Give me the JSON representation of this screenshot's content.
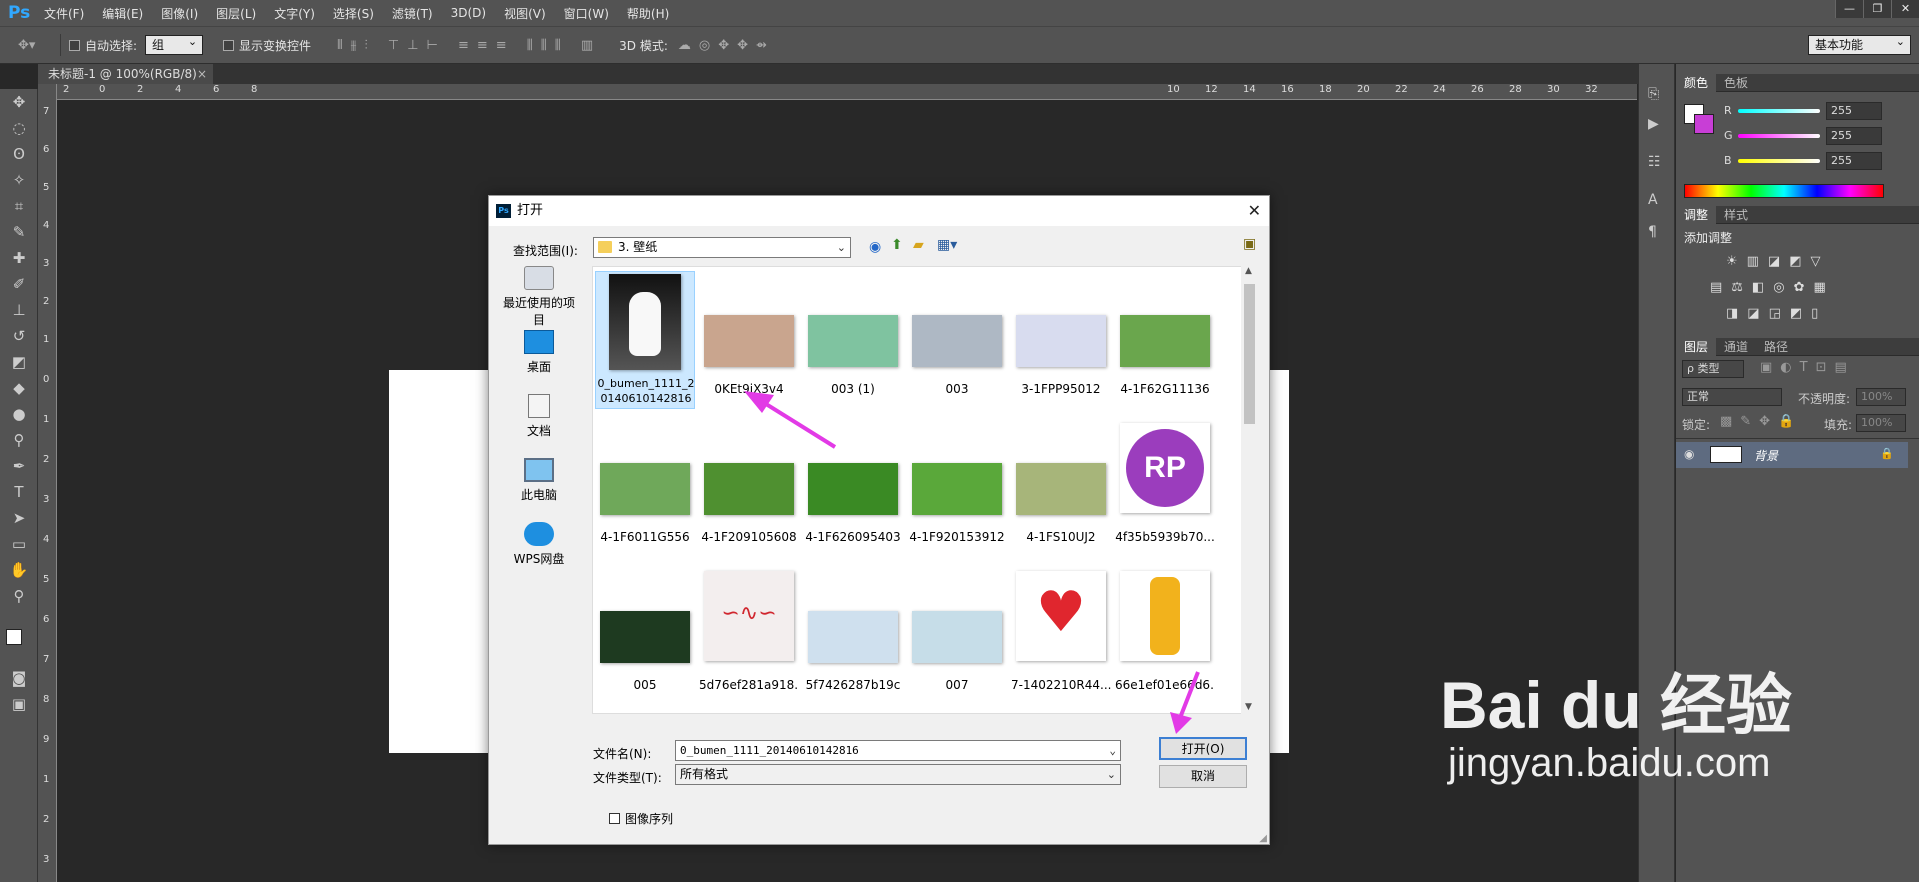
{
  "app": {
    "logo": "Ps"
  },
  "menu": [
    "文件(F)",
    "编辑(E)",
    "图像(I)",
    "图层(L)",
    "文字(Y)",
    "选择(S)",
    "滤镜(T)",
    "3D(D)",
    "视图(V)",
    "窗口(W)",
    "帮助(H)"
  ],
  "window_buttons": [
    "—",
    "❐",
    "✕"
  ],
  "options": {
    "auto_select_label": "自动选择:",
    "auto_select_value": "组",
    "show_transform_label": "显示变换控件",
    "mode3d_label": "3D 模式:",
    "workspace": "基本功能"
  },
  "document_tab": "未标题-1 @ 100%(RGB/8)",
  "ruler_h": [
    "2",
    "0",
    "2",
    "4",
    "6",
    "8",
    "10",
    "12",
    "14",
    "16",
    "18",
    "20",
    "22",
    "24",
    "26",
    "28",
    "30",
    "32"
  ],
  "ruler_v": [
    "7",
    "6",
    "5",
    "4",
    "3",
    "2",
    "1",
    "0",
    "1",
    "2",
    "3",
    "4",
    "5",
    "6",
    "7",
    "8",
    "9",
    "1",
    "2",
    "3"
  ],
  "panels": {
    "color": {
      "tabs": [
        "颜色",
        "色板"
      ],
      "r_label": "R",
      "g_label": "G",
      "b_label": "B",
      "r": "255",
      "g": "255",
      "b": "255"
    },
    "adjust": {
      "tabs": [
        "调整",
        "样式"
      ],
      "title": "添加调整"
    },
    "layers": {
      "tabs": [
        "图层",
        "通道",
        "路径"
      ],
      "filter": "ρ 类型",
      "blend": "正常",
      "opacity_label": "不透明度:",
      "opacity": "100%",
      "lock_label": "锁定:",
      "fill_label": "填充:",
      "fill": "100%",
      "layer_name": "背景"
    }
  },
  "dialog": {
    "title": "打开",
    "look_in_label": "查找范围(I):",
    "look_in_value": "3. 壁纸",
    "places": [
      "最近使用的项目",
      "桌面",
      "文档",
      "此电脑",
      "WPS网盘"
    ],
    "files": [
      {
        "name": "0_bumen_1111_20140610142816",
        "color": "#c8c8c8",
        "selected": true
      },
      {
        "name": "0KEt9jX3v4",
        "color": "#c9a58e"
      },
      {
        "name": "003 (1)",
        "color": "#7fc3a0"
      },
      {
        "name": "003",
        "color": "#aeb8c4"
      },
      {
        "name": "3-1FPP95012",
        "color": "#d8dcef"
      },
      {
        "name": "4-1F62G11136",
        "color": "#6aa64d"
      },
      {
        "name": "4-1F6011G556",
        "color": "#6fa85a"
      },
      {
        "name": "4-1F209105608",
        "color": "#4f9030"
      },
      {
        "name": "4-1F626095403",
        "color": "#3a8a24"
      },
      {
        "name": "4-1F920153912",
        "color": "#5aa83a"
      },
      {
        "name": "4-1FS10UJ2",
        "color": "#a7b57a"
      },
      {
        "name": "4f35b5939b70...",
        "color": "#9b3dbd"
      },
      {
        "name": "005",
        "color": "#1e3a20"
      },
      {
        "name": "5d76ef281a918...",
        "color": "#f3eeee"
      },
      {
        "name": "5f7426287b19c",
        "color": "#cfe0ee"
      },
      {
        "name": "007",
        "color": "#c6dde8"
      },
      {
        "name": "7-1402210R44...",
        "color": "#ffffff"
      },
      {
        "name": "66e1ef01e66d6...",
        "color": "#ffffff"
      }
    ],
    "rp_text": "RP",
    "filename_label": "文件名(N):",
    "filename_value": "0_bumen_1111_20140610142816",
    "filetype_label": "文件类型(T):",
    "filetype_value": "所有格式",
    "open_button": "打开(O)",
    "cancel_button": "取消",
    "image_sequence": "图像序列"
  },
  "watermark": {
    "brand": "Bai du 经验",
    "url": "jingyan.baidu.com"
  },
  "colors": {
    "accent_arrow": "#e23ae6",
    "ps_blue": "#31a8ff"
  }
}
